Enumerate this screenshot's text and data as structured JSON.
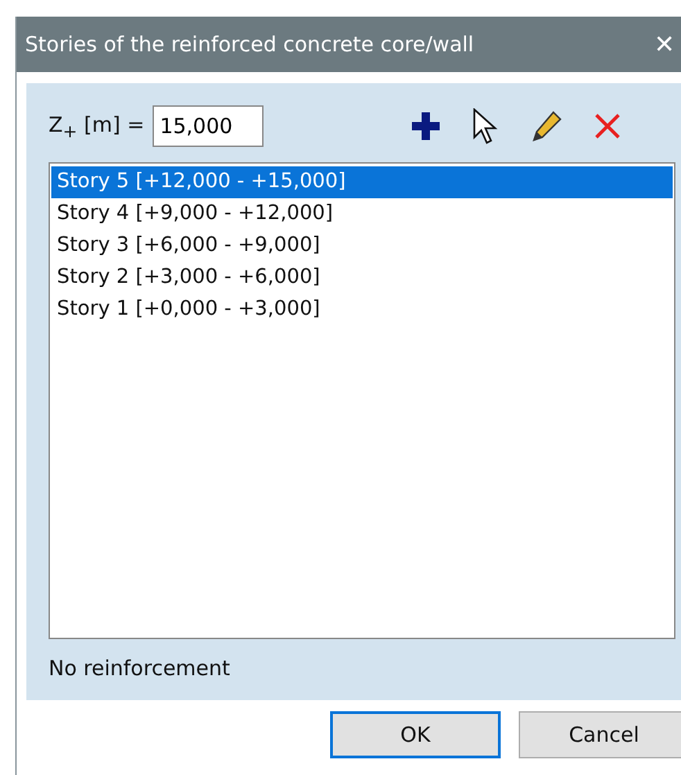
{
  "window": {
    "title": "Stories of the reinforced concrete core/wall",
    "close": "✕"
  },
  "height_field": {
    "label": "Z$_{+}$ [m] =",
    "value": "15,000"
  },
  "stories": [
    {
      "label": "Story 5 [+12,000 - +15,000]",
      "selected": true
    },
    {
      "label": "Story 4 [+9,000 - +12,000]",
      "selected": false
    },
    {
      "label": "Story 3 [+6,000 - +9,000]",
      "selected": false
    },
    {
      "label": "Story 2 [+3,000 - +6,000]",
      "selected": false
    },
    {
      "label": "Story 1 [+0,000 - +3,000]",
      "selected": false
    }
  ],
  "status": "No reinforcement",
  "buttons": [
    {
      "label": "OK",
      "default": true
    },
    {
      "label": "Cancel",
      "default": false
    }
  ]
}
